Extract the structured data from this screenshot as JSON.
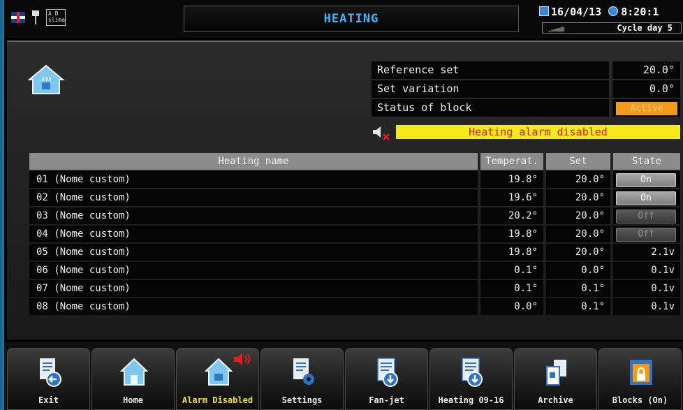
{
  "header": {
    "title": "HEATING",
    "date": "16/04/13",
    "time": "8:20:1",
    "cycle": "Cycle day 5",
    "ab_badge": "A B",
    "ab_sub": "slima"
  },
  "info": {
    "rows": [
      {
        "label": "Reference set",
        "value": "20.0°"
      },
      {
        "label": "Set variation",
        "value": "0.0°"
      },
      {
        "label": "Status of block",
        "value": "Active"
      }
    ],
    "alarm_text": "Heating alarm disabled"
  },
  "table": {
    "headers": {
      "name": "Heating name",
      "temp": "Temperat.",
      "set": "Set",
      "state": "State"
    },
    "rows": [
      {
        "name": "01 (Nome custom)",
        "temp": "19.8°",
        "set": "20.0°",
        "state": "On",
        "state_kind": "on"
      },
      {
        "name": "02 (Nome custom)",
        "temp": "19.6°",
        "set": "20.0°",
        "state": "On",
        "state_kind": "on"
      },
      {
        "name": "03 (Nome custom)",
        "temp": "20.2°",
        "set": "20.0°",
        "state": "Off",
        "state_kind": "off"
      },
      {
        "name": "04 (Nome custom)",
        "temp": "19.8°",
        "set": "20.0°",
        "state": "Off",
        "state_kind": "off"
      },
      {
        "name": "05 (Nome custom)",
        "temp": "19.8°",
        "set": "20.0°",
        "state": "2.1v",
        "state_kind": "text"
      },
      {
        "name": "06 (Nome custom)",
        "temp": "0.1°",
        "set": "0.0°",
        "state": "0.1v",
        "state_kind": "text"
      },
      {
        "name": "07 (Nome custom)",
        "temp": "0.1°",
        "set": "0.1°",
        "state": "0.1v",
        "state_kind": "text"
      },
      {
        "name": "08 (Nome custom)",
        "temp": "0.0°",
        "set": "0.1°",
        "state": "0.1v",
        "state_kind": "text"
      }
    ]
  },
  "toolbar": {
    "buttons": [
      {
        "label": "Exit",
        "icon": "doc-back-icon"
      },
      {
        "label": "Home",
        "icon": "home-icon"
      },
      {
        "label": "Alarm Disabled",
        "icon": "home-alarm-icon"
      },
      {
        "label": "Settings",
        "icon": "doc-gear-icon"
      },
      {
        "label": "Fan-jet",
        "icon": "doc-down-icon"
      },
      {
        "label": "Heating 09-16",
        "icon": "doc-down-icon"
      },
      {
        "label": "Archive",
        "icon": "archive-icon"
      },
      {
        "label": "Blocks (On)",
        "icon": "lock-icon"
      }
    ]
  },
  "colors": {
    "title": "#3fb6ff",
    "active_badge": "#f29a1c",
    "alarm_bar": "#f5ea1c",
    "alarm_text": "#d21b1b",
    "alarm_label": "#f1e31f"
  }
}
